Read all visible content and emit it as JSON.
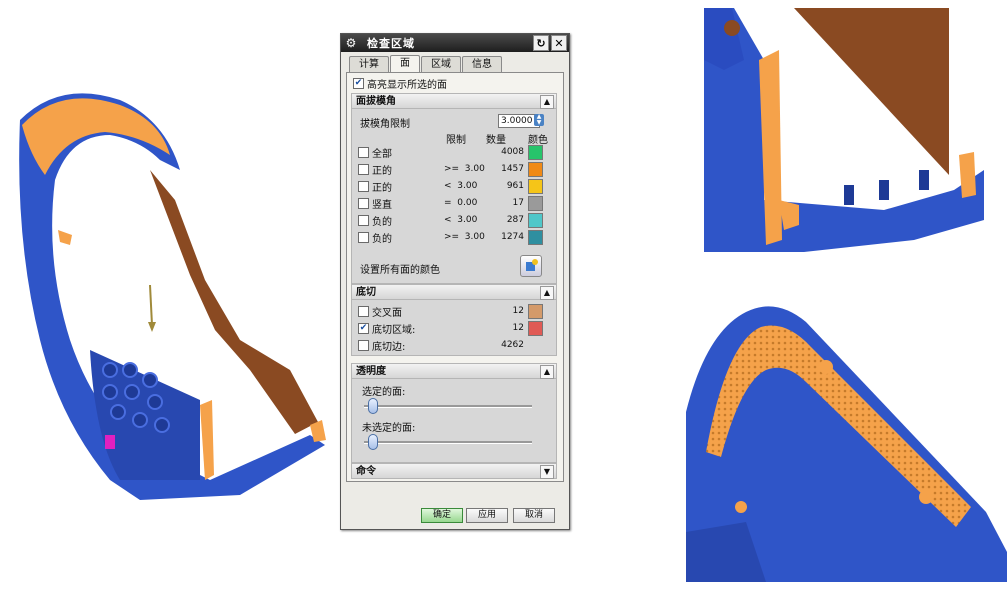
{
  "dialog": {
    "title": "检查区域",
    "tabs": [
      {
        "label": "计算"
      },
      {
        "label": "面"
      },
      {
        "label": "区域"
      },
      {
        "label": "信息"
      }
    ],
    "highlight_label": "高亮显示所选的面",
    "draft_section": {
      "title": "面拔模角",
      "limit_label": "拔模角限制",
      "limit_value": "3.0000",
      "col_limit": "限制",
      "col_count": "数量",
      "col_color": "颜色",
      "rows": [
        {
          "label": "全部",
          "cond": "",
          "count": "4008",
          "color": "#27c46b"
        },
        {
          "label": "正的",
          "cond": ">=  3.00",
          "count": "1457",
          "color": "#f08a16"
        },
        {
          "label": "正的",
          "cond": "<  3.00",
          "count": "961",
          "color": "#f5c518"
        },
        {
          "label": "竖直",
          "cond": "=  0.00",
          "count": "17",
          "color": "#9a9a9a"
        },
        {
          "label": "负的",
          "cond": "<  3.00",
          "count": "287",
          "color": "#4fc7c9"
        },
        {
          "label": "负的",
          "cond": ">=  3.00",
          "count": "1274",
          "color": "#2f8fa0"
        }
      ],
      "set_color_label": "设置所有面的颜色"
    },
    "undercut_section": {
      "title": "底切",
      "rows": [
        {
          "label": "交叉面",
          "count": "12",
          "checked": false,
          "color": "#d49a6a"
        },
        {
          "label": "底切区域:",
          "count": "12",
          "checked": true,
          "color": "#e05a55"
        },
        {
          "label": "底切边:",
          "count": "4262",
          "checked": false,
          "color": ""
        }
      ]
    },
    "transparency_section": {
      "title": "透明度",
      "selected_label": "选定的面:",
      "selected_value": 0,
      "unselected_label": "未选定的面:",
      "unselected_value": 0
    },
    "command_section": {
      "title": "命令"
    },
    "buttons": {
      "ok": "确定",
      "apply": "应用",
      "cancel": "取消"
    }
  }
}
